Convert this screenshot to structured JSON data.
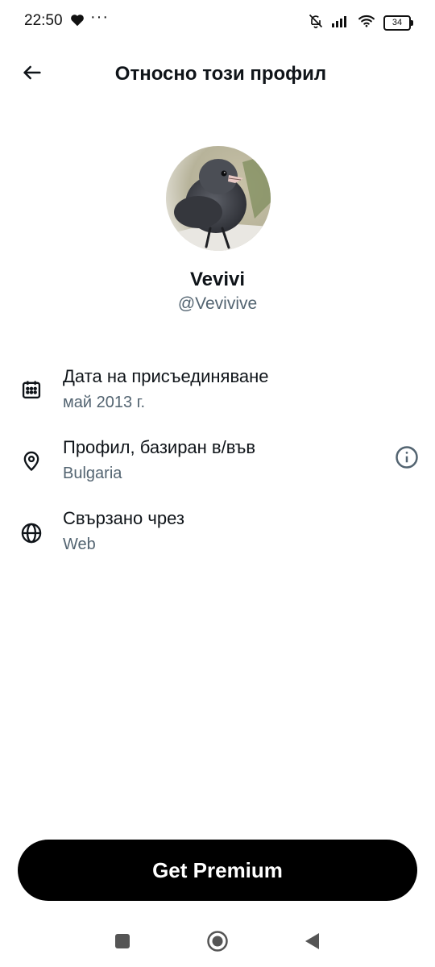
{
  "status_bar": {
    "time": "22:50",
    "dots": "···",
    "battery": "34",
    "icons": [
      "heart-icon",
      "bell-off-icon",
      "signal-icon",
      "wifi-icon",
      "battery-icon"
    ]
  },
  "header": {
    "title": "Относно този профил",
    "back_icon": "arrow-left-icon"
  },
  "profile": {
    "display_name": "Vevivi",
    "handle": "@Vevivive"
  },
  "details": [
    {
      "icon": "calendar-icon",
      "label": "Дата на присъединяване",
      "value": "май 2013 г."
    },
    {
      "icon": "location-pin-icon",
      "label": "Профил, базиран в/във",
      "value": "Bulgaria",
      "action_icon": "info-icon"
    },
    {
      "icon": "globe-icon",
      "label": "Свързано чрез",
      "value": "Web"
    }
  ],
  "cta": {
    "label": "Get Premium"
  },
  "nav": [
    "recents-icon",
    "home-icon",
    "back-icon"
  ],
  "colors": {
    "primary_text": "#0f1419",
    "secondary_text": "#536471",
    "button_bg": "#000000",
    "button_text": "#ffffff"
  }
}
